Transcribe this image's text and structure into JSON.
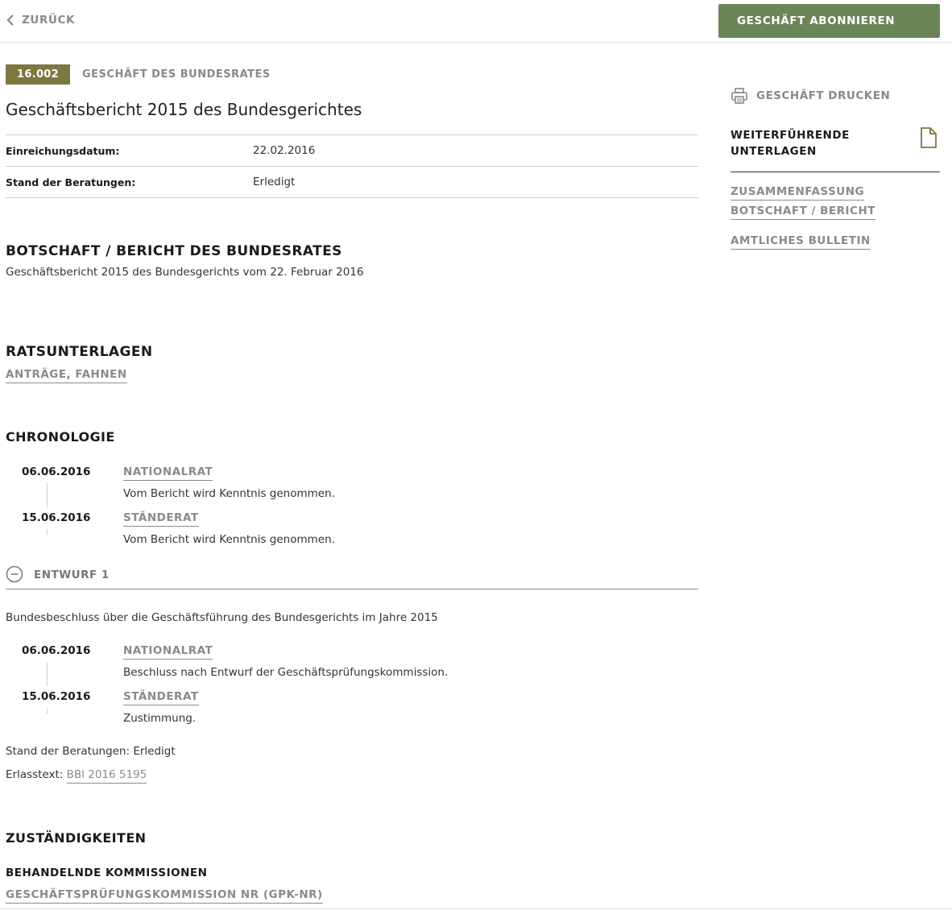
{
  "header": {
    "back_label": "ZURÜCK",
    "subscribe_label": "GESCHÄFT ABONNIEREN"
  },
  "business": {
    "number": "16.002",
    "type": "GESCHÄFT DES BUNDESRATES",
    "title": "Geschäftsbericht 2015 des Bundesgerichtes"
  },
  "info": {
    "rows": [
      {
        "key": "Einreichungsdatum:",
        "value": "22.02.2016"
      },
      {
        "key": "Stand der Beratungen:",
        "value": "Erledigt"
      }
    ]
  },
  "message": {
    "heading": "BOTSCHAFT / BERICHT DES BUNDESRATES",
    "text": "Geschäftsbericht 2015 des Bundesgerichts vom 22. Februar 2016"
  },
  "council_documents": {
    "heading": "RATSUNTERLAGEN",
    "link": "ANTRÄGE, FAHNEN"
  },
  "chronology": {
    "heading": "CHRONOLOGIE",
    "entries": [
      {
        "date": "06.06.2016",
        "council": "NATIONALRAT",
        "text": "Vom Bericht wird Kenntnis genommen."
      },
      {
        "date": "15.06.2016",
        "council": "STÄNDERAT",
        "text": "Vom Bericht wird Kenntnis genommen."
      }
    ]
  },
  "draft": {
    "label": "ENTWURF 1",
    "description": "Bundesbeschluss über die Geschäftsführung des Bundesgerichts im Jahre 2015",
    "entries": [
      {
        "date": "06.06.2016",
        "council": "NATIONALRAT",
        "text": "Beschluss nach Entwurf der Geschäftsprüfungskommission."
      },
      {
        "date": "15.06.2016",
        "council": "STÄNDERAT",
        "text": "Zustimmung."
      }
    ],
    "status": "Stand der Beratungen: Erledigt",
    "decree_label": "Erlasstext:",
    "decree_link": "BBl 2016 5195"
  },
  "responsibilities": {
    "heading": "ZUSTÄNDIGKEITEN",
    "subheading": "BEHANDELNDE KOMMISSIONEN",
    "commission": "GESCHÄFTSPRÜFUNGSKOMMISSION NR (GPK-NR)"
  },
  "sidebar": {
    "print_label": "GESCHÄFT DRUCKEN",
    "docs_line1": "WEITERFÜHRENDE",
    "docs_line2": "UNTERLAGEN",
    "links": [
      "ZUSAMMENFASSUNG",
      "BOTSCHAFT / BERICHT",
      "AMTLICHES BULLETIN"
    ]
  },
  "colors": {
    "accent_green": "#6a8659",
    "badge_olive": "#7d7740",
    "link_gray": "#8a8a8a"
  },
  "icons": [
    "chevron-left-icon",
    "printer-icon",
    "document-icon",
    "minus-circle-icon"
  ]
}
